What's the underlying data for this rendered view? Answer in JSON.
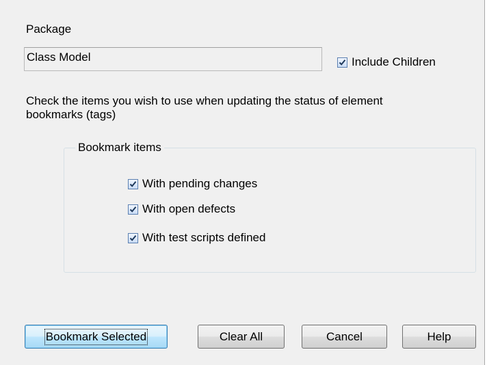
{
  "package": {
    "label": "Package",
    "value": "Class Model",
    "include_children": {
      "label": "Include Children",
      "checked": true
    }
  },
  "description": {
    "line1": "Check the items you wish to use when updating the status of element",
    "line2": "bookmarks (tags)"
  },
  "bookmark_items": {
    "title": "Bookmark items",
    "items": [
      {
        "label": "With pending changes",
        "checked": true
      },
      {
        "label": "With open defects",
        "checked": true
      },
      {
        "label": "With test scripts defined",
        "checked": true
      }
    ]
  },
  "buttons": {
    "bookmark_selected": "Bookmark Selected",
    "clear_all": "Clear All",
    "cancel": "Cancel",
    "help": "Help"
  },
  "colors": {
    "dialog_background": "#f0f0f0",
    "checkmark": "#1e395b",
    "default_button_border": "#3c7fb1"
  }
}
